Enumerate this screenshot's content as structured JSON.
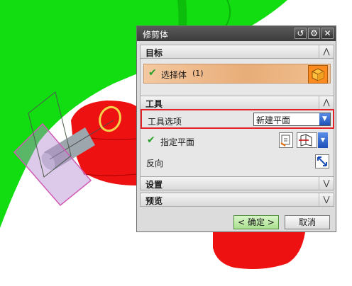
{
  "dialog": {
    "title": "修剪体",
    "icons": [
      "reset-icon",
      "gear-icon",
      "close-icon"
    ]
  },
  "sections": {
    "target": {
      "title": "目标",
      "state": "expanded"
    },
    "tool": {
      "title": "工具",
      "state": "expanded"
    },
    "settings": {
      "title": "设置",
      "state": "collapsed"
    },
    "preview": {
      "title": "预览",
      "state": "collapsed"
    }
  },
  "target": {
    "select_body_label": "选择体",
    "select_count": "(1)",
    "cube_icon": "solid-body-icon"
  },
  "tool": {
    "option_label": "工具选项",
    "option_value": "新建平面",
    "plane_label": "指定平面",
    "reverse_label": "反向"
  },
  "buttons": {
    "ok_label": "< 确定 >",
    "cancel_label": "取消"
  },
  "colors": {
    "title_bar": "#3c3c3c",
    "selection_row": "#e8ad78",
    "highlight_box": "#e2232a",
    "ok_button": "#a9df8e",
    "model_green": "#11dd11",
    "model_red": "#ee1111"
  }
}
